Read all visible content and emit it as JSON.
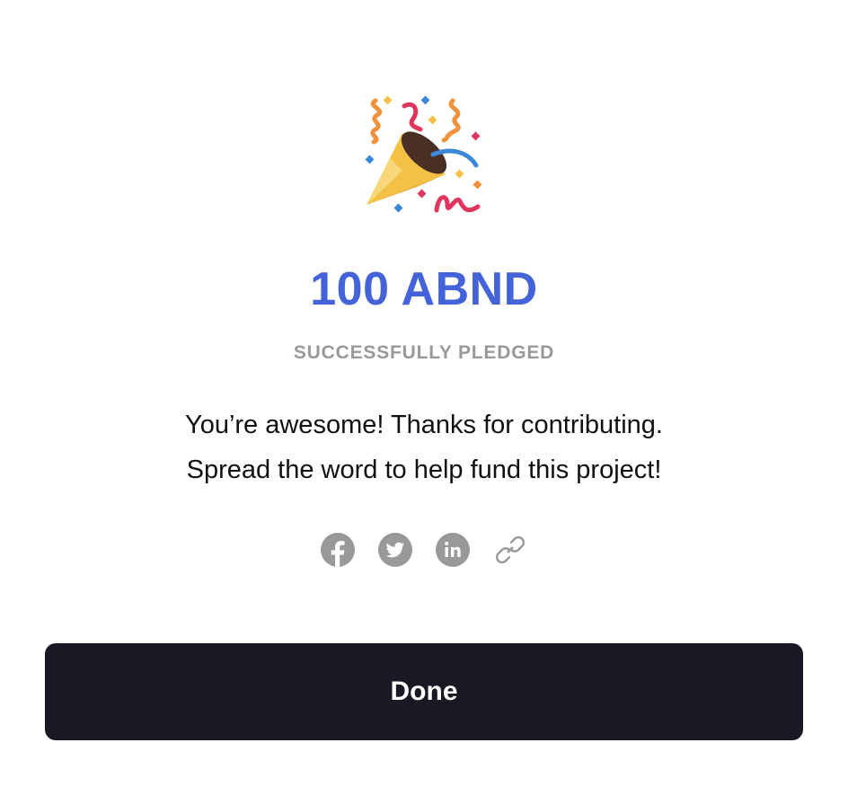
{
  "celebration": {
    "icon": "party-popper-icon"
  },
  "pledge": {
    "amount": "100 ABND",
    "status": "SUCCESSFULLY PLEDGED"
  },
  "message": {
    "line1": "You’re awesome! Thanks for contributing.",
    "line2": "Spread the word to help fund this project!"
  },
  "share": {
    "icon_color": "#999999",
    "buttons": [
      {
        "icon": "facebook-icon"
      },
      {
        "icon": "twitter-icon"
      },
      {
        "icon": "linkedin-icon"
      },
      {
        "icon": "link-icon"
      }
    ]
  },
  "actions": {
    "done_label": "Done"
  },
  "colors": {
    "accent": "#4463d9",
    "button_bg": "#1b1824",
    "muted": "#999999"
  }
}
